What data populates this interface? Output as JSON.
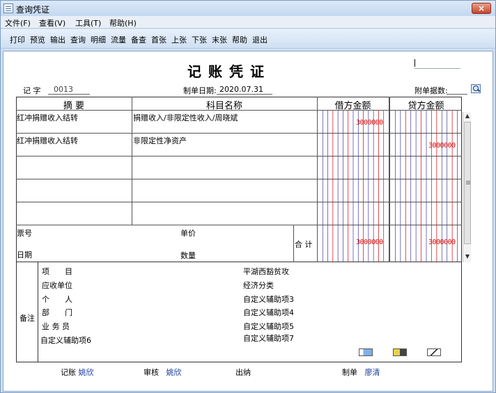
{
  "window": {
    "title": "查询凭证",
    "close": "×"
  },
  "menu": [
    "文件(F)",
    "查看(V)",
    "工具(T)",
    "帮助(H)"
  ],
  "toolbar": [
    "打印",
    "预览",
    "输出",
    "查询",
    "明细",
    "流量",
    "备查",
    "首张",
    "上张",
    "下张",
    "末张",
    "帮助",
    "退出"
  ],
  "voucher": {
    "title": "记账凭证",
    "type_label": "记 字",
    "number": "0013",
    "date_label": "制单日期:",
    "date": "2020.07.31",
    "attach_label": "附单据数:"
  },
  "columns": {
    "summary": "摘 要",
    "account": "科目名称",
    "debit": "借方金额",
    "credit": "贷方金额"
  },
  "rows": [
    {
      "summary": "红冲捐赠收入结转",
      "account": "捐赠收入/非限定性收入/周晓斌",
      "debit": "3000000",
      "credit": ""
    },
    {
      "summary": "红冲捐赠收入结转",
      "account": "非限定性净资产",
      "debit": "",
      "credit": "3000000"
    },
    {
      "summary": "",
      "account": "",
      "debit": "",
      "credit": ""
    },
    {
      "summary": "",
      "account": "",
      "debit": "",
      "credit": ""
    },
    {
      "summary": "",
      "account": "",
      "debit": "",
      "credit": ""
    }
  ],
  "footer": {
    "ticket_label": "票号",
    "date_label": "日期",
    "price_label": "单价",
    "qty_label": "数量",
    "total_label": "合 计",
    "total_debit": "3000000",
    "total_credit": "3000000"
  },
  "notes": {
    "side_label": "备注",
    "left": [
      "项　　目",
      "应收单位",
      "个　　人",
      "部　　门",
      "业 务 员",
      "自定义辅助项6"
    ],
    "right": [
      "平湖西豁贫攻",
      "经济分类",
      "自定义辅助项3",
      "自定义辅助项4",
      "自定义辅助项5",
      "自定义辅助项7"
    ]
  },
  "signatures": {
    "bookkeeper_label": "记账",
    "bookkeeper": "姚欣",
    "reviewer_label": "审核",
    "reviewer": "姚欣",
    "cashier_label": "出纳",
    "maker_label": "制单",
    "maker": "廖清"
  },
  "colors": {
    "accent_red": "#d40000",
    "grid_blue": "#3a3aa0",
    "grid_red": "#d40000"
  },
  "icons": [
    "app-icon",
    "close-icon",
    "search-icon",
    "scroll-up-icon",
    "scroll-down-icon",
    "note-icon",
    "card-icon",
    "edit-icon"
  ]
}
